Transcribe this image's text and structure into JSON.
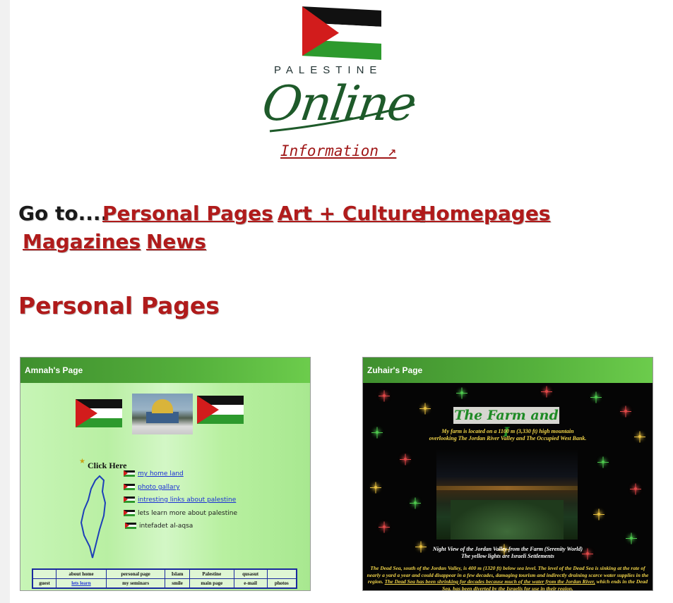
{
  "header": {
    "logo_top": "PALESTINE",
    "logo_main": "Online",
    "info_link": "Information ↗"
  },
  "nav": {
    "goto": "Go to....",
    "links": [
      "Personal Pages",
      "Art + Culture",
      "Homepages",
      "Magazines",
      "News"
    ]
  },
  "section_title": "Personal Pages",
  "thumbnails": [
    {
      "title": "Amnah's Page",
      "click_here": "Click Here",
      "links": [
        "my home land",
        "photo gallary",
        "intresting links about palestine",
        "lets learn more about palestine",
        "intefadet al-aqsa"
      ],
      "nav_row1": [
        "",
        "about home",
        "personal page",
        "Islam",
        "Palestine",
        "qusasut",
        ""
      ],
      "nav_row2": [
        "guest",
        "lets learn",
        "my seminars",
        "smile",
        "main page",
        "e-mail",
        "photos"
      ]
    },
    {
      "title": "Zuhair's Page",
      "heading": "The Farm and I",
      "intro1": "My farm is located on a 1100 m (3,330 ft) high mountain",
      "intro2": "overlooking The Jordan River Valley and The Occupied West Bank.",
      "caption1": "Night View of the Jordan Valley from the Farm (Serenity World)",
      "caption2": "The yellow lights are Israeli Settlements",
      "para_a": "The Dead Sea, south of the Jordan Valley, is 400 m (1320 ft) below sea level. The level of the Dead Sea is sinking at the rate of nearly a yard a year and could disappear in a few decades, damaging tourism and indirectly draining scarce water supplies in the region.",
      "para_link": "The Dead Sea has been shrinking for decades because much of the water from the Jordan River,",
      "para_b": "which ends in the Dead Sea, has been diverted by the Israelis for use in their region."
    }
  ]
}
